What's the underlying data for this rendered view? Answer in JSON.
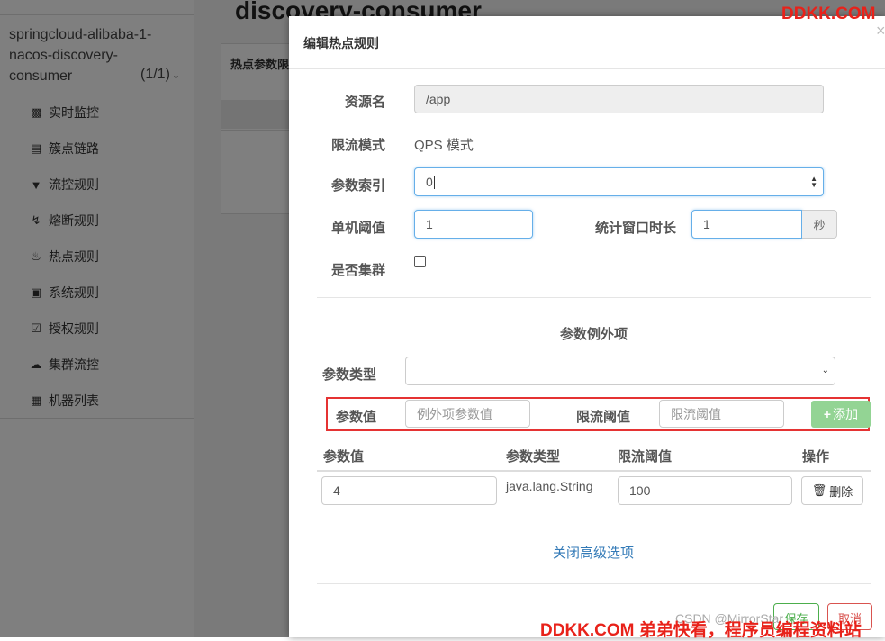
{
  "page": {
    "title": "discovery-consumer",
    "panel_header": "热点参数限",
    "app_name_lines": [
      "springcloud-alibaba-1-",
      "nacos-discovery-",
      "consumer"
    ],
    "app_count": "(1/1)"
  },
  "sidebar": {
    "items": [
      {
        "label": "实时监控",
        "icon": "bar-chart-icon"
      },
      {
        "label": "簇点链路",
        "icon": "list-icon"
      },
      {
        "label": "流控规则",
        "icon": "filter-icon"
      },
      {
        "label": "熔断规则",
        "icon": "flash-icon"
      },
      {
        "label": "热点规则",
        "icon": "fire-icon"
      },
      {
        "label": "系统规则",
        "icon": "lock-icon"
      },
      {
        "label": "授权规则",
        "icon": "check-square-icon"
      },
      {
        "label": "集群流控",
        "icon": "cloud-icon"
      },
      {
        "label": "机器列表",
        "icon": "th-list-icon"
      }
    ]
  },
  "modal": {
    "title": "编辑热点规则",
    "close": "×",
    "resource_label": "资源名",
    "resource_value": "/app",
    "mode_label": "限流模式",
    "mode_value": "QPS 模式",
    "param_index_label": "参数索引",
    "param_index_value": "0",
    "threshold_label": "单机阈值",
    "threshold_value": "1",
    "window_label": "统计窗口时长",
    "window_value": "1",
    "window_unit": "秒",
    "cluster_label": "是否集群",
    "cluster_checked": false,
    "exceptions_title": "参数例外项",
    "param_type_label": "参数类型",
    "param_type_value": "",
    "exc_value_label": "参数值",
    "exc_value_placeholder": "例外项参数值",
    "exc_threshold_label": "限流阈值",
    "exc_threshold_placeholder": "限流阈值",
    "add_button": "添加",
    "table": {
      "headers": [
        "参数值",
        "参数类型",
        "限流阈值",
        "操作"
      ],
      "rows": [
        {
          "value": "4",
          "type": "java.lang.String",
          "threshold": "100",
          "action": "删除"
        }
      ]
    },
    "close_advanced": "关闭高级选项",
    "save_button": "保存",
    "cancel_button": "取消"
  },
  "watermarks": {
    "top": "DDKK.COM",
    "bottom": "DDKK.COM 弟弟快看，程序员编程资料站",
    "csdn": "CSDN @MirrorStar"
  },
  "colors": {
    "accent_blue": "#337ab7",
    "focus_border": "#66afe9",
    "add_button": "#93d494",
    "highlight_box": "#e53333",
    "watermark": "#e8221a"
  }
}
